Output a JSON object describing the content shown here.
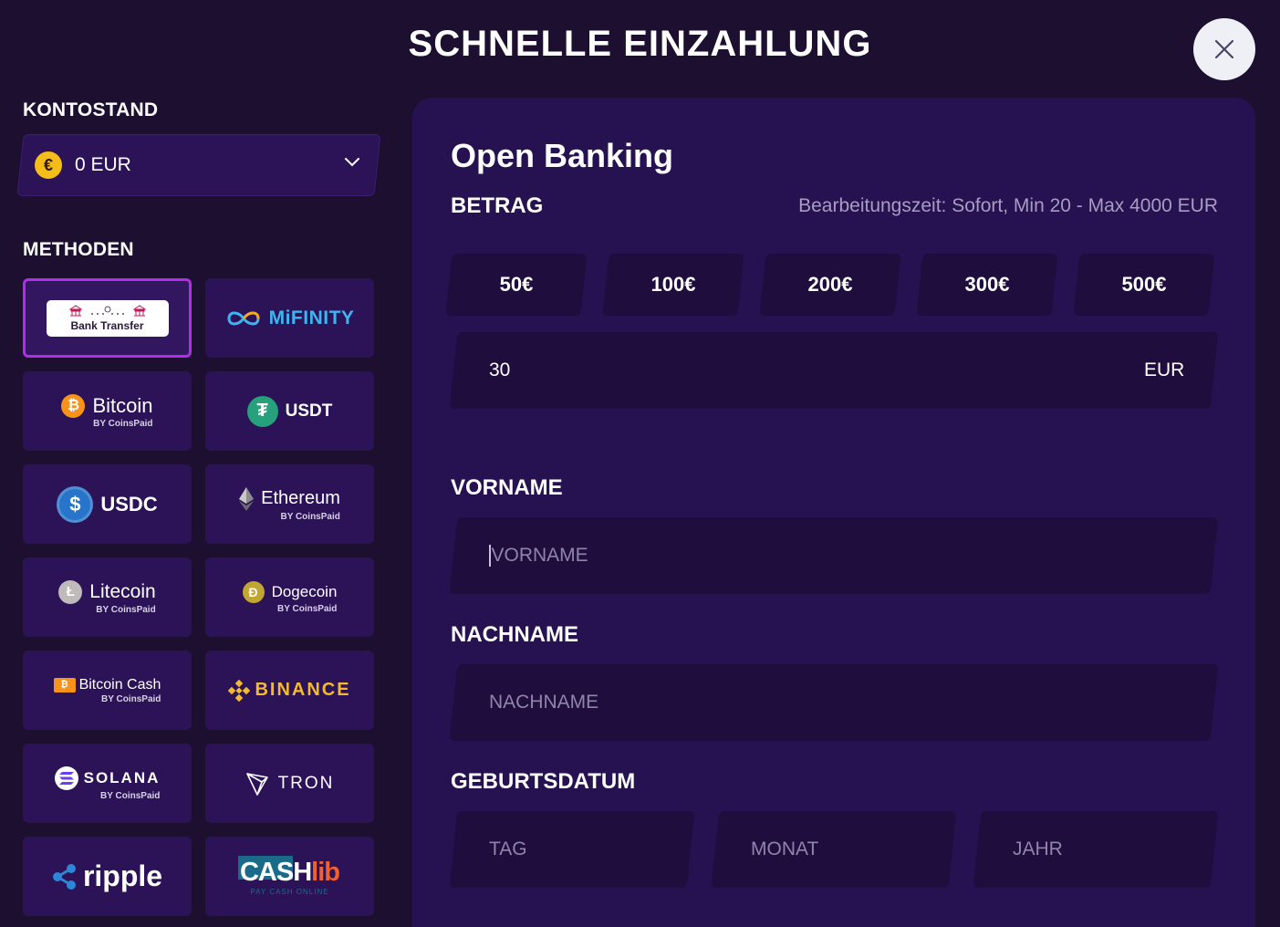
{
  "header": {
    "title": "SCHNELLE EINZAHLUNG"
  },
  "balance": {
    "label": "KONTOSTAND",
    "value": "0 EUR",
    "currency_symbol": "€"
  },
  "methods": {
    "label": "METHODEN",
    "items": [
      {
        "name": "Bank Transfer",
        "selected": true
      },
      {
        "name": "MiFINITY"
      },
      {
        "name": "Bitcoin",
        "sub": "BY CoinsPaid"
      },
      {
        "name": "USDT"
      },
      {
        "name": "USDC"
      },
      {
        "name": "Ethereum",
        "sub": "BY CoinsPaid"
      },
      {
        "name": "Litecoin",
        "sub": "BY CoinsPaid"
      },
      {
        "name": "Dogecoin",
        "sub": "BY CoinsPaid"
      },
      {
        "name": "Bitcoin Cash",
        "sub": "BY CoinsPaid"
      },
      {
        "name": "BINANCE"
      },
      {
        "name": "SOLANA",
        "sub": "BY CoinsPaid"
      },
      {
        "name": "TRON"
      },
      {
        "name": "ripple"
      },
      {
        "name": "CASHlib",
        "sub": "PAY CASH ONLINE"
      }
    ]
  },
  "form": {
    "title": "Open Banking",
    "amount_label": "BETRAG",
    "info": "Bearbeitungszeit: Sofort, Min 20 - Max 4000 EUR",
    "presets": [
      "50€",
      "100€",
      "200€",
      "300€",
      "500€"
    ],
    "amount_value": "30",
    "amount_currency": "EUR",
    "first_name_label": "VORNAME",
    "first_name_placeholder": "VORNAME",
    "last_name_label": "NACHNAME",
    "last_name_placeholder": "NACHNAME",
    "dob_label": "GEBURTSDATUM",
    "dob_day": "TAG",
    "dob_month": "MONAT",
    "dob_year": "JAHR"
  },
  "colors": {
    "background": "#1c0f30",
    "panel": "#261250",
    "tile": "#2c1358",
    "selected_border": "#b02ee8",
    "bitcoin": "#f7931a",
    "usdt": "#26a17b",
    "usdc": "#2775ca",
    "binance": "#f3ba2f",
    "mifinity": "#3fb4f0"
  }
}
